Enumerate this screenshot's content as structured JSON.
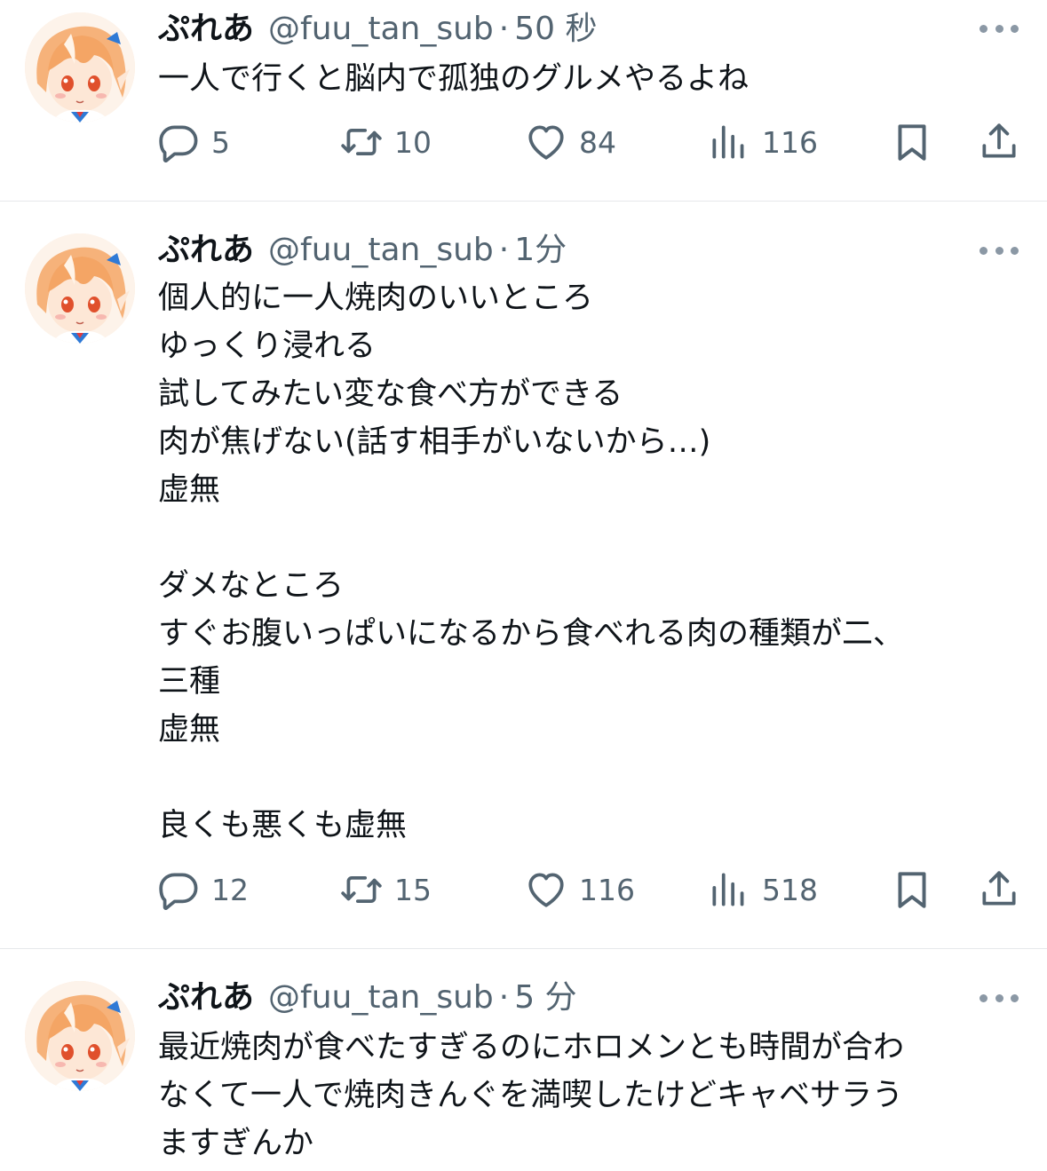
{
  "tweets": [
    {
      "name": "ぷれあ",
      "handle": "@fuu_tan_sub",
      "separator": "·",
      "time": "50 秒",
      "lines": [
        "一人で行くと脳内で孤独のグルメやるよね"
      ],
      "counts": {
        "replies": "5",
        "retweets": "10",
        "likes": "84",
        "views": "116"
      }
    },
    {
      "name": "ぷれあ",
      "handle": "@fuu_tan_sub",
      "separator": "·",
      "time": "1分",
      "lines": [
        "個人的に一人焼肉のいいところ",
        "ゆっくり浸れる",
        "試してみたい変な食べ方ができる",
        "肉が焦げない(話す相手がいないから…)",
        "虚無",
        "",
        "ダメなところ",
        "すぐお腹いっぱいになるから食べれる肉の種類が二、",
        "三種",
        "虚無",
        "",
        "良くも悪くも虚無"
      ],
      "counts": {
        "replies": "12",
        "retweets": "15",
        "likes": "116",
        "views": "518"
      }
    },
    {
      "name": "ぷれあ",
      "handle": "@fuu_tan_sub",
      "separator": "·",
      "time": "5 分",
      "lines": [
        "最近焼肉が食べたすぎるのにホロメンとも時間が合わ",
        "なくて一人で焼肉きんぐを満喫したけどキャベサラう",
        "ますぎんか"
      ]
    }
  ],
  "icons": {
    "reply": "reply-icon",
    "retweet": "retweet-icon",
    "like": "heart-icon",
    "views": "views-icon",
    "bookmark": "bookmark-icon",
    "share": "share-icon",
    "more": "more-icon"
  },
  "colors": {
    "text": "#0f1419",
    "secondary": "#536471",
    "divider": "#e6e8eb"
  }
}
